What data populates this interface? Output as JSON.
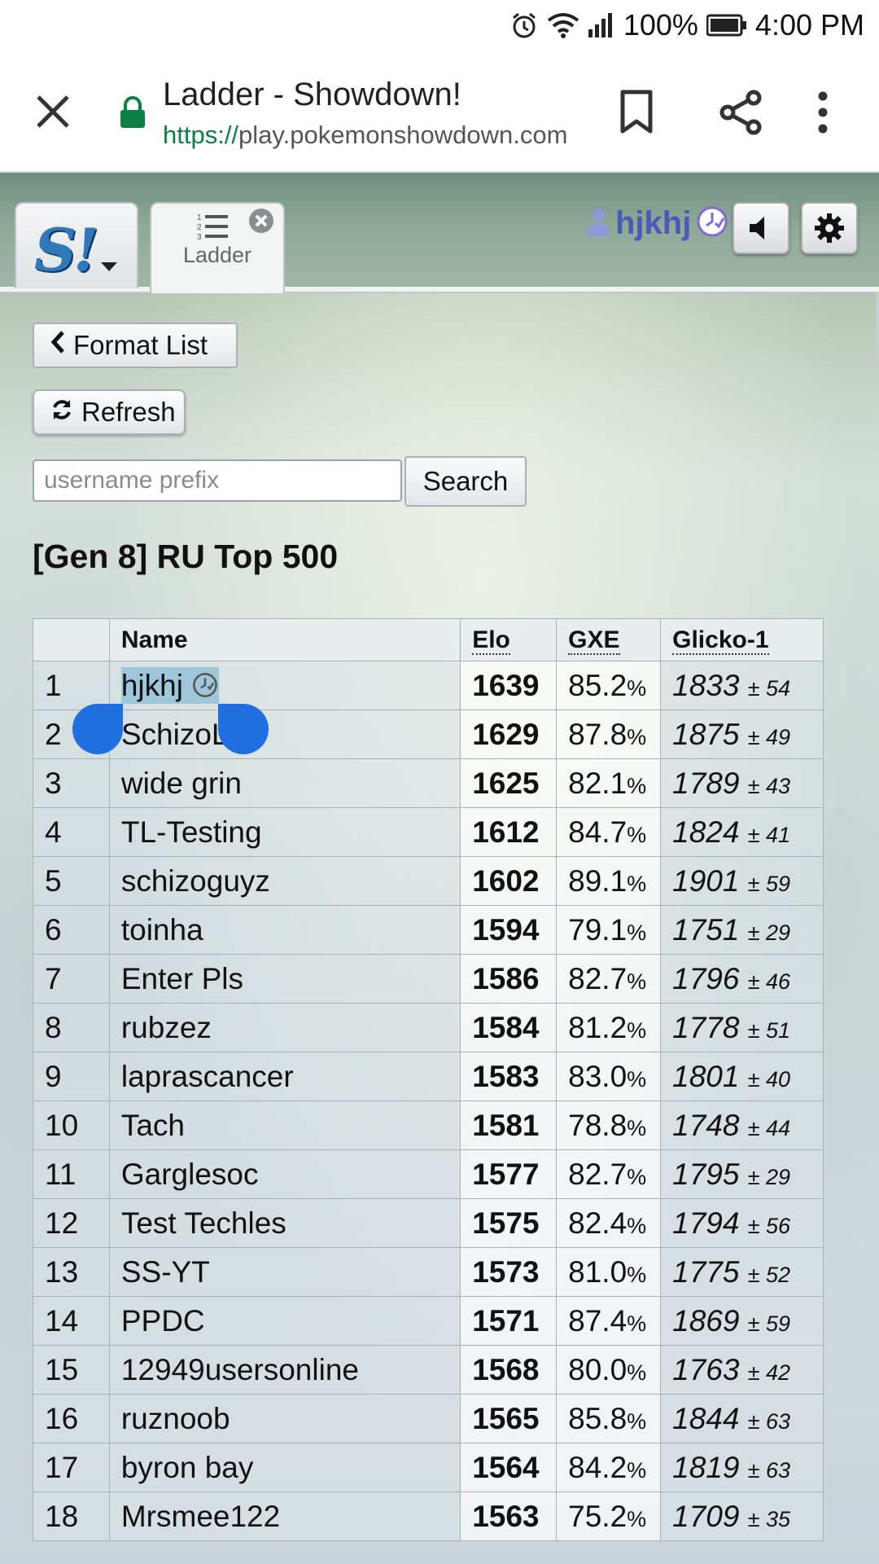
{
  "status_bar": {
    "battery": "100%",
    "time": "4:00 PM"
  },
  "browser": {
    "page_title": "Ladder - Showdown!",
    "url_scheme": "https://",
    "url_host": "play.pokemonshowdown.com"
  },
  "header": {
    "tab_label": "Ladder",
    "username": "hjkhj"
  },
  "controls": {
    "format_list_label": "Format List",
    "refresh_label": "Refresh",
    "search_placeholder": "username prefix",
    "search_label": "Search"
  },
  "ladder": {
    "title": "[Gen 8] RU Top 500",
    "columns": [
      "",
      "Name",
      "Elo",
      "GXE",
      "Glicko-1"
    ],
    "rows": [
      {
        "rank": "1",
        "name": "hjkhj",
        "elo": "1639",
        "gxe": "85.2",
        "glicko": "1833",
        "dev": "± 54"
      },
      {
        "rank": "2",
        "name": "SchizoL",
        "elo": "1629",
        "gxe": "87.8",
        "glicko": "1875",
        "dev": "± 49"
      },
      {
        "rank": "3",
        "name": "wide grin",
        "elo": "1625",
        "gxe": "82.1",
        "glicko": "1789",
        "dev": "± 43"
      },
      {
        "rank": "4",
        "name": "TL-Testing",
        "elo": "1612",
        "gxe": "84.7",
        "glicko": "1824",
        "dev": "± 41"
      },
      {
        "rank": "5",
        "name": "schizoguyz",
        "elo": "1602",
        "gxe": "89.1",
        "glicko": "1901",
        "dev": "± 59"
      },
      {
        "rank": "6",
        "name": "toinha",
        "elo": "1594",
        "gxe": "79.1",
        "glicko": "1751",
        "dev": "± 29"
      },
      {
        "rank": "7",
        "name": "Enter Pls",
        "elo": "1586",
        "gxe": "82.7",
        "glicko": "1796",
        "dev": "± 46"
      },
      {
        "rank": "8",
        "name": "rubzez",
        "elo": "1584",
        "gxe": "81.2",
        "glicko": "1778",
        "dev": "± 51"
      },
      {
        "rank": "9",
        "name": "laprascancer",
        "elo": "1583",
        "gxe": "83.0",
        "glicko": "1801",
        "dev": "± 40"
      },
      {
        "rank": "10",
        "name": "Tach",
        "elo": "1581",
        "gxe": "78.8",
        "glicko": "1748",
        "dev": "± 44"
      },
      {
        "rank": "11",
        "name": "Garglesoc",
        "elo": "1577",
        "gxe": "82.7",
        "glicko": "1795",
        "dev": "± 29"
      },
      {
        "rank": "12",
        "name": "Test Techles",
        "elo": "1575",
        "gxe": "82.4",
        "glicko": "1794",
        "dev": "± 56"
      },
      {
        "rank": "13",
        "name": "SS-YT",
        "elo": "1573",
        "gxe": "81.0",
        "glicko": "1775",
        "dev": "± 52"
      },
      {
        "rank": "14",
        "name": "PPDC",
        "elo": "1571",
        "gxe": "87.4",
        "glicko": "1869",
        "dev": "± 59"
      },
      {
        "rank": "15",
        "name": "12949usersonline",
        "elo": "1568",
        "gxe": "80.0",
        "glicko": "1763",
        "dev": "± 42"
      },
      {
        "rank": "16",
        "name": "ruznoob",
        "elo": "1565",
        "gxe": "85.8",
        "glicko": "1844",
        "dev": "± 63"
      },
      {
        "rank": "17",
        "name": "byron bay",
        "elo": "1564",
        "gxe": "84.2",
        "glicko": "1819",
        "dev": "± 63"
      },
      {
        "rank": "18",
        "name": "Mrsmee122",
        "elo": "1563",
        "gxe": "75.2",
        "glicko": "1709",
        "dev": "± 35"
      }
    ],
    "percent_sign": "%"
  },
  "colors": {
    "username": "#4b59b8",
    "selection": "#9ec7db",
    "selection_handle": "#1f6fe0",
    "logo": "#2f79b8",
    "secure_lock": "#0b8043"
  }
}
